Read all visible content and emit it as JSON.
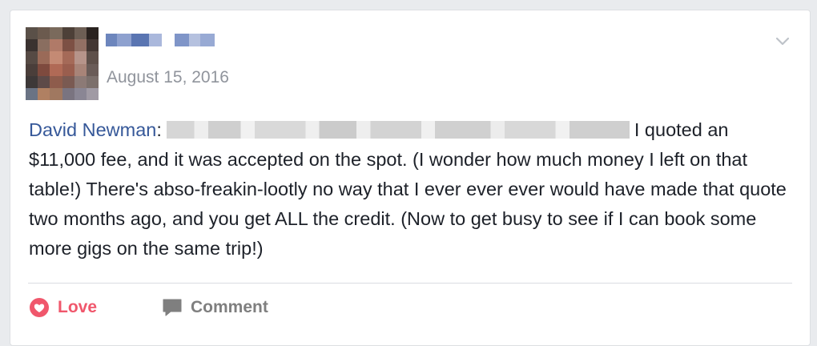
{
  "post": {
    "date": "August 15, 2016",
    "author": "David Newman",
    "author_suffix": ":",
    "body_text": "I quoted an $11,000 fee, and it was accepted on the spot. (I wonder how much money I left on that table!) There's abso-freakin-lootly no way that I ever ever ever would have made that quote two months ago, and you get ALL the credit. (Now to get busy to see if I can book some more gigs on the same trip!)"
  },
  "actions": {
    "love_label": "Love",
    "comment_label": "Comment"
  },
  "icons": {
    "love": "heart-circle-icon",
    "comment": "speech-bubble-icon",
    "menu": "chevron-down-icon"
  },
  "colors": {
    "author_link": "#365899",
    "love": "#f0576c",
    "secondary_text": "#90949c",
    "body_text": "#1d2129"
  }
}
